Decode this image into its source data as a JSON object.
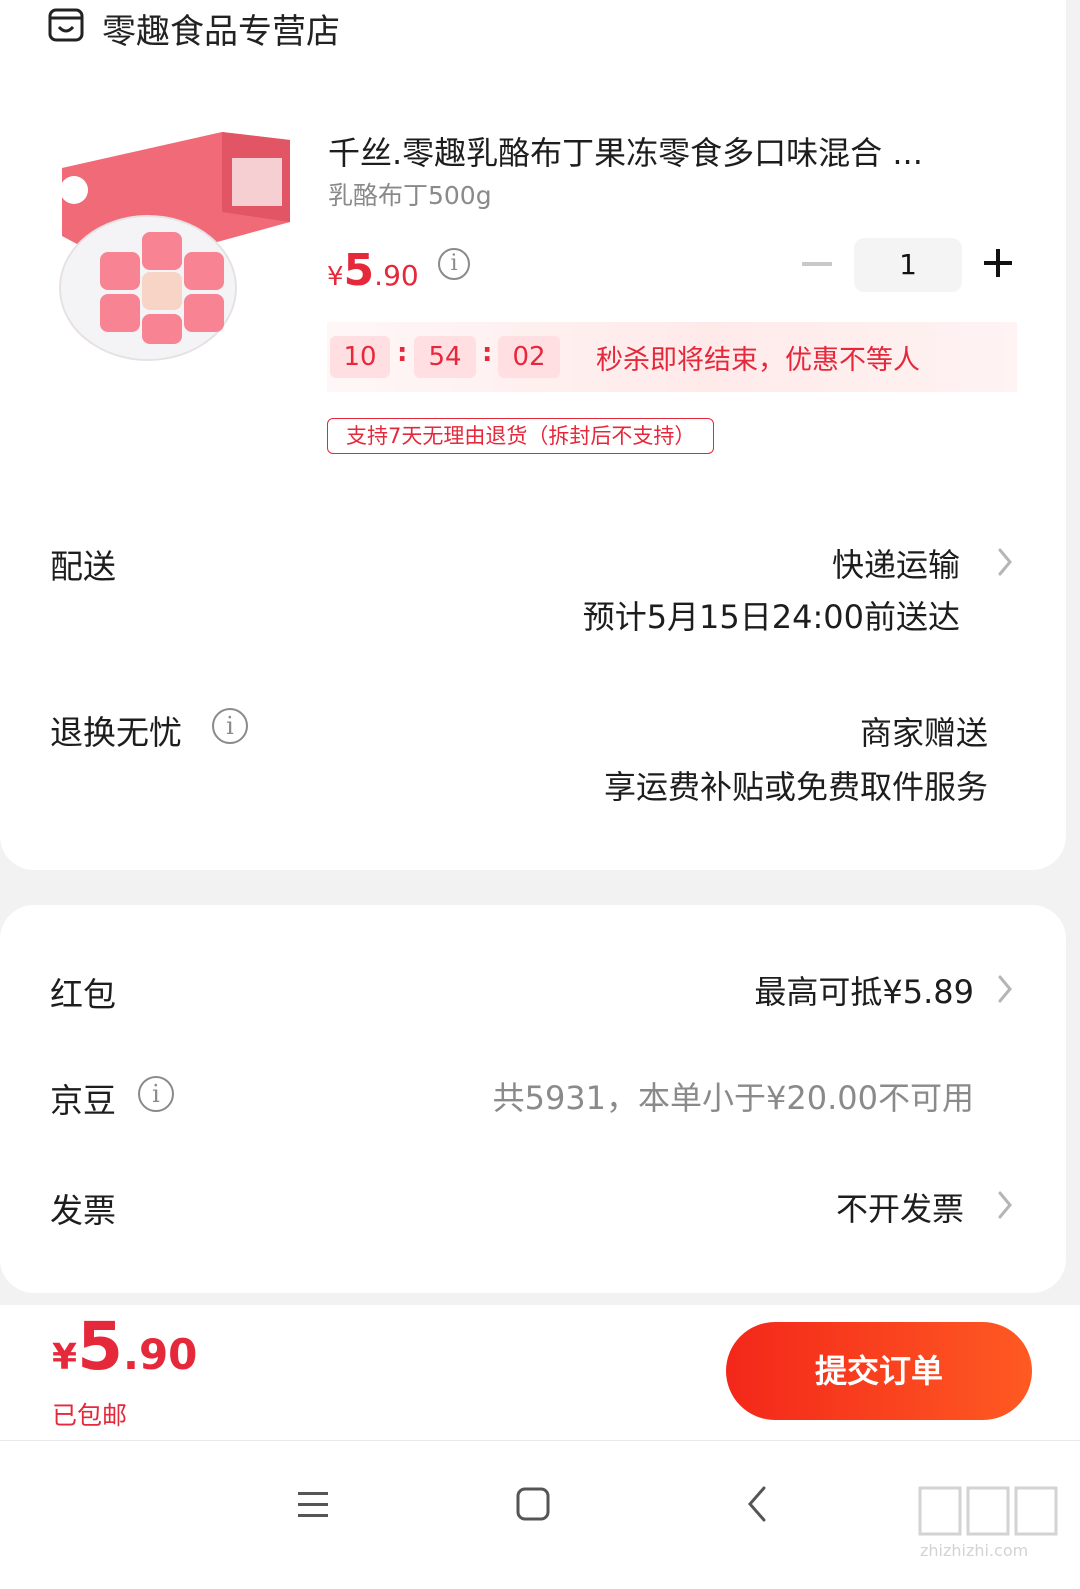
{
  "store": {
    "name": "零趣食品专营店",
    "icon": "store-icon"
  },
  "product": {
    "title": "千丝.零趣乳酪布丁果冻零食多口味混合 ...",
    "spec": "乳酪布丁500g",
    "price_symbol": "¥",
    "price_int": "5",
    "price_dec": ".90",
    "quantity": "1"
  },
  "flash_sale": {
    "hours": "10",
    "minutes": "54",
    "seconds": "02",
    "separator": ":",
    "message": "秒杀即将结束，优惠不等人"
  },
  "return_policy_tag": "支持7天无理由退货（拆封后不支持）",
  "delivery": {
    "label": "配送",
    "method": "快递运输",
    "eta": "预计5月15日24:00前送达"
  },
  "worry_free_return": {
    "label": "退换无忧",
    "value_line1": "商家赠送",
    "value_line2": "享运费补贴或免费取件服务"
  },
  "red_packet": {
    "label": "红包",
    "value": "最高可抵¥5.89"
  },
  "jd_beans": {
    "label": "京豆",
    "value": "共5931，本单小于¥20.00不可用"
  },
  "invoice": {
    "label": "发票",
    "value": "不开发票"
  },
  "footer": {
    "total_symbol": "¥",
    "total_int": "5",
    "total_dec": ".90",
    "shipping_note": "已包邮",
    "submit_label": "提交订单"
  },
  "watermark": "值值值 zhizhizhi.com",
  "colors": {
    "accent": "#e6283b",
    "button_start": "#f3271a",
    "button_end": "#ff5a22"
  }
}
